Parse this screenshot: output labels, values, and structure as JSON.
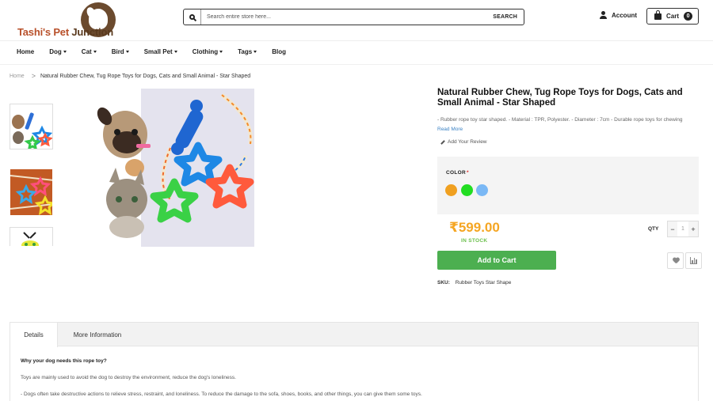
{
  "header": {
    "logo_text_part1": "Tashi's Pet",
    "logo_text_part2": " Junction",
    "search_placeholder": "Search entire store here...",
    "search_button": "SEARCH",
    "account_label": "Account",
    "cart_label": "Cart",
    "cart_count": "0"
  },
  "nav": {
    "items": [
      {
        "label": "Home"
      },
      {
        "label": "Dog"
      },
      {
        "label": "Cat"
      },
      {
        "label": "Bird"
      },
      {
        "label": "Small Pet"
      },
      {
        "label": "Clothing"
      },
      {
        "label": "Tags"
      },
      {
        "label": "Blog"
      }
    ]
  },
  "breadcrumb": {
    "home": "Home",
    "separator": ">",
    "current": "Natural Rubber Chew, Tug Rope Toys for Dogs, Cats and Small Animal - Star Shaped"
  },
  "product": {
    "title": "Natural Rubber Chew, Tug Rope Toys for Dogs, Cats and Small Animal - Star Shaped",
    "short_description": "- Rubber rope toy star shaped. - Material : TPR, Polyester. - Diameter : 7cm - Durable rope toys for chewing",
    "read_more": "Read More",
    "add_review": "Add Your Review",
    "color_label": "COLOR",
    "required_mark": "*",
    "colors": [
      "#f0a020",
      "#22dd22",
      "#7ab8f5"
    ],
    "price": "₹599.00",
    "stock": "IN STOCK",
    "qty_label": "QTY",
    "qty_minus": "−",
    "qty_value": "1",
    "qty_plus": "+",
    "add_to_cart": "Add to Cart",
    "sku_label": "SKU:",
    "sku_value": "Rubber Toys Star Shape"
  },
  "tabs": {
    "items": [
      {
        "label": "Details"
      },
      {
        "label": "More Information"
      }
    ],
    "details": {
      "question": "Why your dog needs this rope toy?",
      "para1": "Toys are mainly used to avoid the dog to destroy the environment, reduce the dog's loneliness.",
      "para2": "- Dogs often take destructive actions to relieve stress, restraint, and loneliness. To reduce the damage to the sofa, shoes, books, and other things, you can give them some toys."
    }
  }
}
